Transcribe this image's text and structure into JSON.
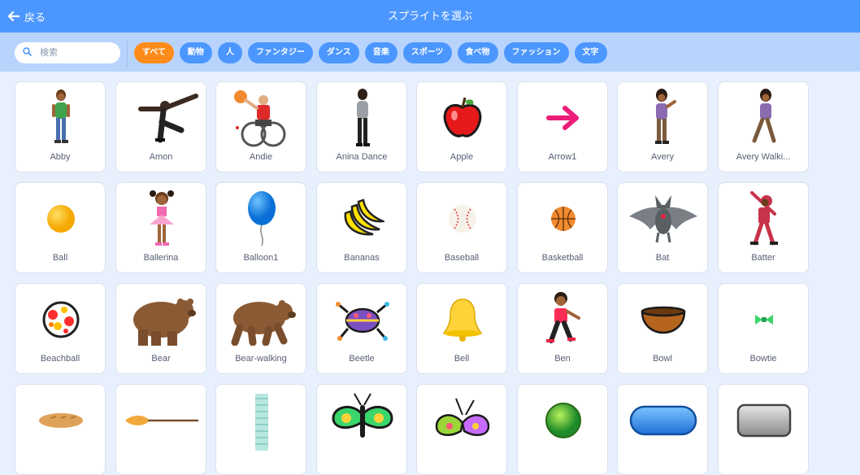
{
  "header": {
    "back_label": "戻る",
    "title": "スプライトを選ぶ"
  },
  "search": {
    "placeholder": "検索",
    "value": ""
  },
  "tags": [
    {
      "label": "すべて",
      "active": true
    },
    {
      "label": "動物",
      "active": false
    },
    {
      "label": "人",
      "active": false
    },
    {
      "label": "ファンタジー",
      "active": false
    },
    {
      "label": "ダンス",
      "active": false
    },
    {
      "label": "音楽",
      "active": false
    },
    {
      "label": "スポーツ",
      "active": false
    },
    {
      "label": "食べ物",
      "active": false
    },
    {
      "label": "ファッション",
      "active": false
    },
    {
      "label": "文字",
      "active": false
    }
  ],
  "colors": {
    "header": "#4c97ff",
    "filterbar": "#b8d4fd",
    "active_tag": "#ff8c1a",
    "tag": "#4c97ff"
  },
  "sprites": [
    {
      "name": "Abby",
      "icon": "abby-icon"
    },
    {
      "name": "Amon",
      "icon": "amon-icon"
    },
    {
      "name": "Andie",
      "icon": "andie-icon"
    },
    {
      "name": "Anina Dance",
      "icon": "anina-dance-icon"
    },
    {
      "name": "Apple",
      "icon": "apple-icon"
    },
    {
      "name": "Arrow1",
      "icon": "arrow1-icon"
    },
    {
      "name": "Avery",
      "icon": "avery-icon"
    },
    {
      "name": "Avery Walki...",
      "icon": "avery-walking-icon"
    },
    {
      "name": "Ball",
      "icon": "ball-icon"
    },
    {
      "name": "Ballerina",
      "icon": "ballerina-icon"
    },
    {
      "name": "Balloon1",
      "icon": "balloon1-icon"
    },
    {
      "name": "Bananas",
      "icon": "bananas-icon"
    },
    {
      "name": "Baseball",
      "icon": "baseball-icon"
    },
    {
      "name": "Basketball",
      "icon": "basketball-icon"
    },
    {
      "name": "Bat",
      "icon": "bat-icon"
    },
    {
      "name": "Batter",
      "icon": "batter-icon"
    },
    {
      "name": "Beachball",
      "icon": "beachball-icon"
    },
    {
      "name": "Bear",
      "icon": "bear-icon"
    },
    {
      "name": "Bear-walking",
      "icon": "bear-walking-icon"
    },
    {
      "name": "Beetle",
      "icon": "beetle-icon"
    },
    {
      "name": "Bell",
      "icon": "bell-icon"
    },
    {
      "name": "Ben",
      "icon": "ben-icon"
    },
    {
      "name": "Bowl",
      "icon": "bowl-icon"
    },
    {
      "name": "Bowtie",
      "icon": "bowtie-icon"
    },
    {
      "name": "",
      "icon": "bread-icon"
    },
    {
      "name": "",
      "icon": "broom-icon"
    },
    {
      "name": "",
      "icon": "building-icon"
    },
    {
      "name": "",
      "icon": "butterfly-icon"
    },
    {
      "name": "",
      "icon": "butterfly2-icon"
    },
    {
      "name": "",
      "icon": "button-green-icon"
    },
    {
      "name": "",
      "icon": "button-blue-icon"
    },
    {
      "name": "",
      "icon": "button-gray-icon"
    }
  ]
}
